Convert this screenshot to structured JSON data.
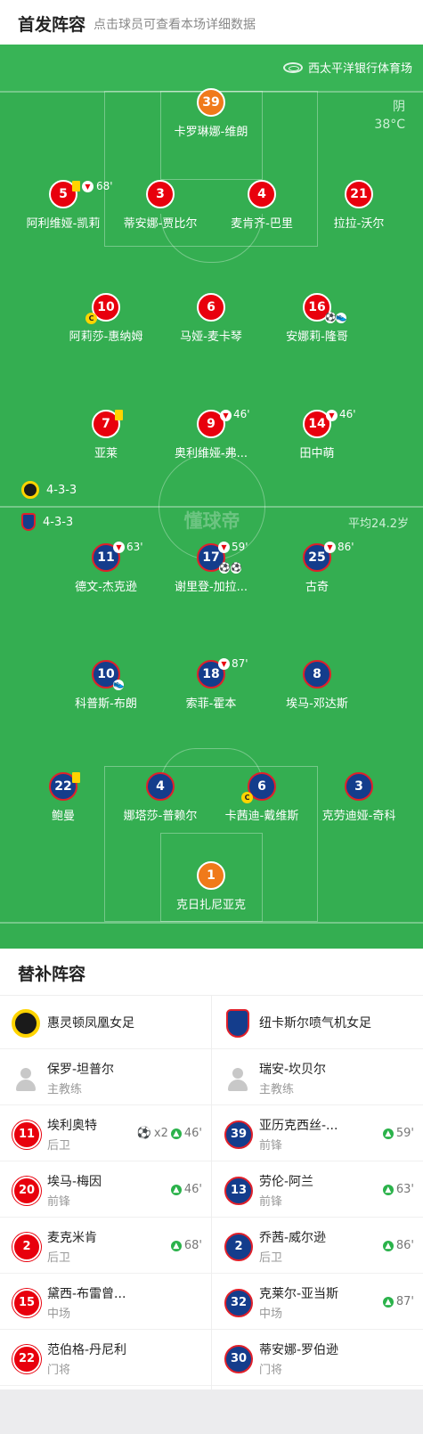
{
  "header": {
    "title": "首发阵容",
    "subtitle": "点击球员可查看本场详细数据"
  },
  "venue": "西太平洋银行体育场",
  "weather": {
    "condition": "阴",
    "temp": "38°C"
  },
  "watermark": "懂球帝",
  "home": {
    "formation": "4-3-3",
    "players": {
      "gk": {
        "num": "39",
        "name": "卡罗琳娜-维朗"
      },
      "d1": {
        "num": "5",
        "name": "阿利维娅-凯莉",
        "sub": "68'"
      },
      "d2": {
        "num": "3",
        "name": "蒂安娜-贾比尔"
      },
      "d3": {
        "num": "4",
        "name": "麦肯齐-巴里"
      },
      "d4": {
        "num": "21",
        "name": "拉拉-沃尔"
      },
      "m1": {
        "num": "10",
        "name": "阿莉莎-惠纳姆"
      },
      "m2": {
        "num": "6",
        "name": "马娅-麦卡琴"
      },
      "m3": {
        "num": "16",
        "name": "安娜莉-隆哥"
      },
      "f1": {
        "num": "7",
        "name": "亚莱"
      },
      "f2": {
        "num": "9",
        "name": "奥利维娅-弗...",
        "sub": "46'"
      },
      "f3": {
        "num": "14",
        "name": "田中萌",
        "sub": "46'"
      }
    }
  },
  "away": {
    "formation": "4-3-3",
    "avg_age": "平均24.2岁",
    "players": {
      "f1": {
        "num": "11",
        "name": "德文-杰克逊",
        "sub": "63'"
      },
      "f2": {
        "num": "17",
        "name": "谢里登-加拉...",
        "sub": "59'"
      },
      "f3": {
        "num": "25",
        "name": "古奇",
        "sub": "86'"
      },
      "m1": {
        "num": "10",
        "name": "科普斯-布朗"
      },
      "m2": {
        "num": "18",
        "name": "索菲-霍本",
        "sub": "87'"
      },
      "m3": {
        "num": "8",
        "name": "埃马-邓达斯"
      },
      "d1": {
        "num": "22",
        "name": "鲍曼"
      },
      "d2": {
        "num": "4",
        "name": "娜塔莎-普赖尔"
      },
      "d3": {
        "num": "6",
        "name": "卡茜迪-戴维斯"
      },
      "d4": {
        "num": "3",
        "name": "克劳迪娅-奇科"
      },
      "gk": {
        "num": "1",
        "name": "克日扎尼亚克"
      }
    }
  },
  "subs": {
    "title": "替补阵容",
    "home": {
      "team": "惠灵顿凤凰女足",
      "coach": {
        "name": "保罗-坦普尔",
        "role": "主教练"
      },
      "list": [
        {
          "num": "11",
          "name": "埃利奥特",
          "pos": "后卫",
          "goals": "x2",
          "min": "46'"
        },
        {
          "num": "20",
          "name": "埃马-梅因",
          "pos": "前锋",
          "min": "46'"
        },
        {
          "num": "2",
          "name": "麦克米肯",
          "pos": "后卫",
          "min": "68'"
        },
        {
          "num": "15",
          "name": "黛西-布雷曾...",
          "pos": "中场"
        },
        {
          "num": "22",
          "name": "范伯格-丹尼利",
          "pos": "门将"
        }
      ]
    },
    "away": {
      "team": "纽卡斯尔喷气机女足",
      "coach": {
        "name": "瑞安-坎贝尔",
        "role": "主教练"
      },
      "list": [
        {
          "num": "39",
          "name": "亚历克西丝-...",
          "pos": "前锋",
          "min": "59'"
        },
        {
          "num": "13",
          "name": "劳伦-阿兰",
          "pos": "前锋",
          "min": "63'"
        },
        {
          "num": "2",
          "name": "乔茜-威尔逊",
          "pos": "后卫",
          "min": "86'"
        },
        {
          "num": "32",
          "name": "克莱尔-亚当斯",
          "pos": "中场",
          "min": "87'"
        },
        {
          "num": "30",
          "name": "蒂安娜-罗伯逊",
          "pos": "门将"
        }
      ]
    }
  }
}
